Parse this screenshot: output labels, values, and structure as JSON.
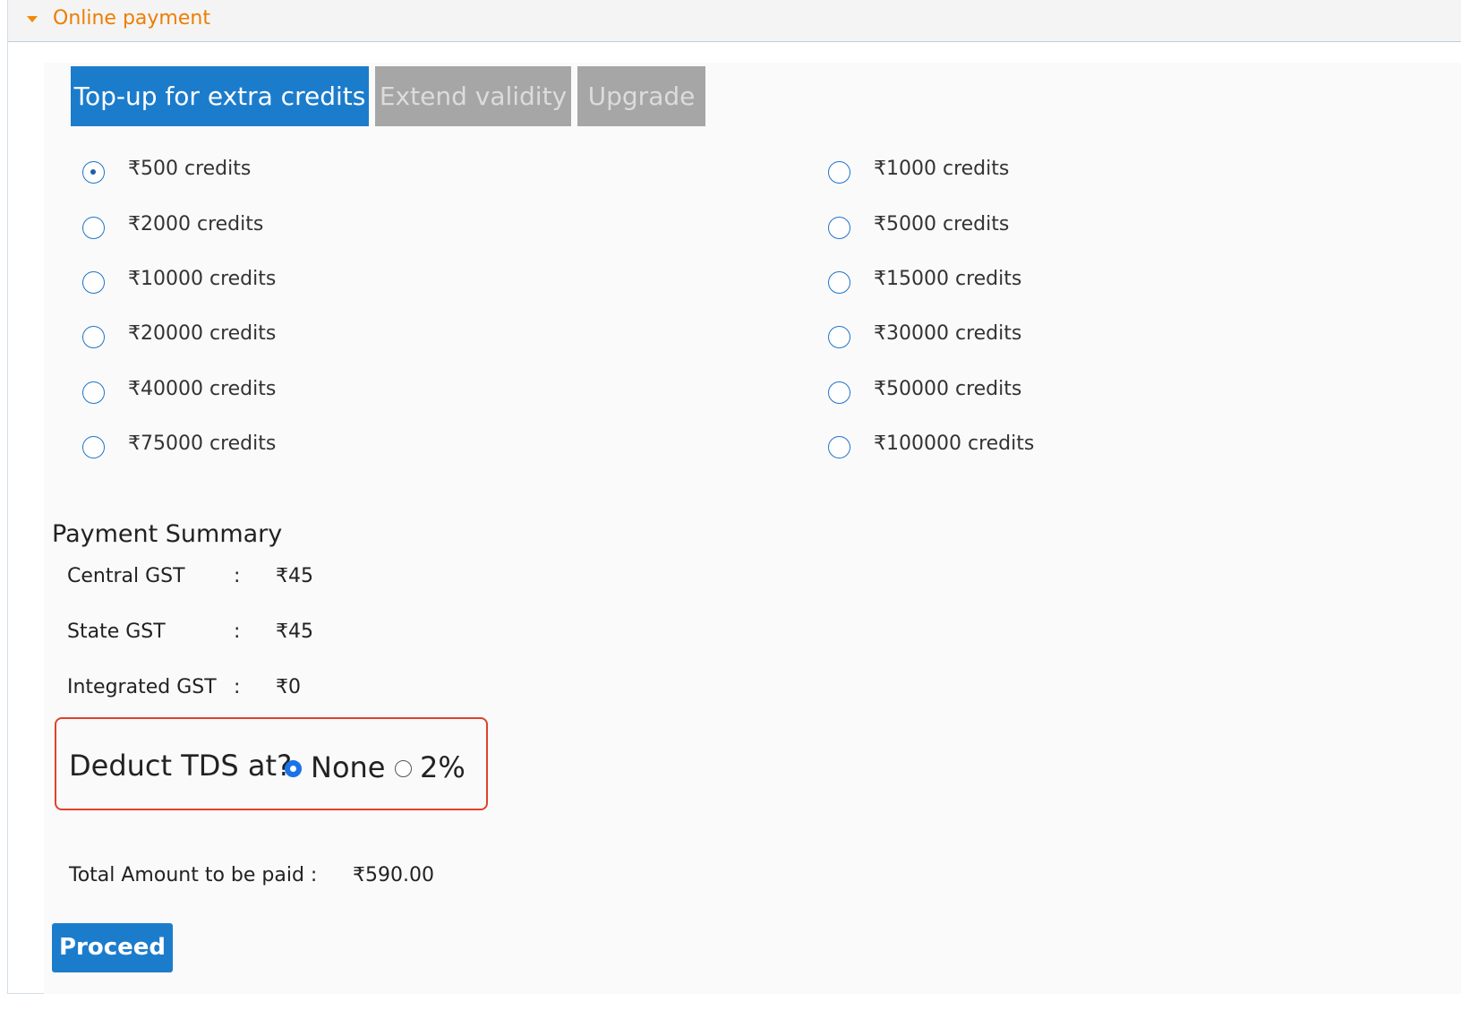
{
  "panel": {
    "title": "Online payment"
  },
  "tabs": [
    {
      "label": "Top-up for extra credits",
      "active": true
    },
    {
      "label": "Extend validity",
      "active": false
    },
    {
      "label": "Upgrade",
      "active": false
    }
  ],
  "credit_options": {
    "selected": "₹500 credits",
    "left": [
      "₹500 credits",
      "₹2000 credits",
      "₹10000 credits",
      "₹20000 credits",
      "₹40000 credits",
      "₹75000 credits"
    ],
    "right": [
      "₹1000 credits",
      "₹5000 credits",
      "₹15000 credits",
      "₹30000 credits",
      "₹50000 credits",
      "₹100000 credits"
    ]
  },
  "summary": {
    "title": "Payment Summary",
    "rows": [
      {
        "label": "Central GST",
        "colon": ":",
        "value": "₹45"
      },
      {
        "label": "State GST",
        "colon": ":",
        "value": "₹45"
      },
      {
        "label": "Integrated GST",
        "colon": ":",
        "value": "₹0"
      }
    ]
  },
  "tds": {
    "label": "Deduct TDS at?",
    "options": [
      "None",
      "2%"
    ],
    "selected": "None"
  },
  "total": {
    "label": "Total Amount to be paid :",
    "value": "₹590.00"
  },
  "proceed_label": "Proceed",
  "colors": {
    "accent": "#1c7ccc",
    "header_title": "#ee7d00",
    "inactive_tab": "#a6a6a6",
    "highlight_border": "#e0412b"
  }
}
